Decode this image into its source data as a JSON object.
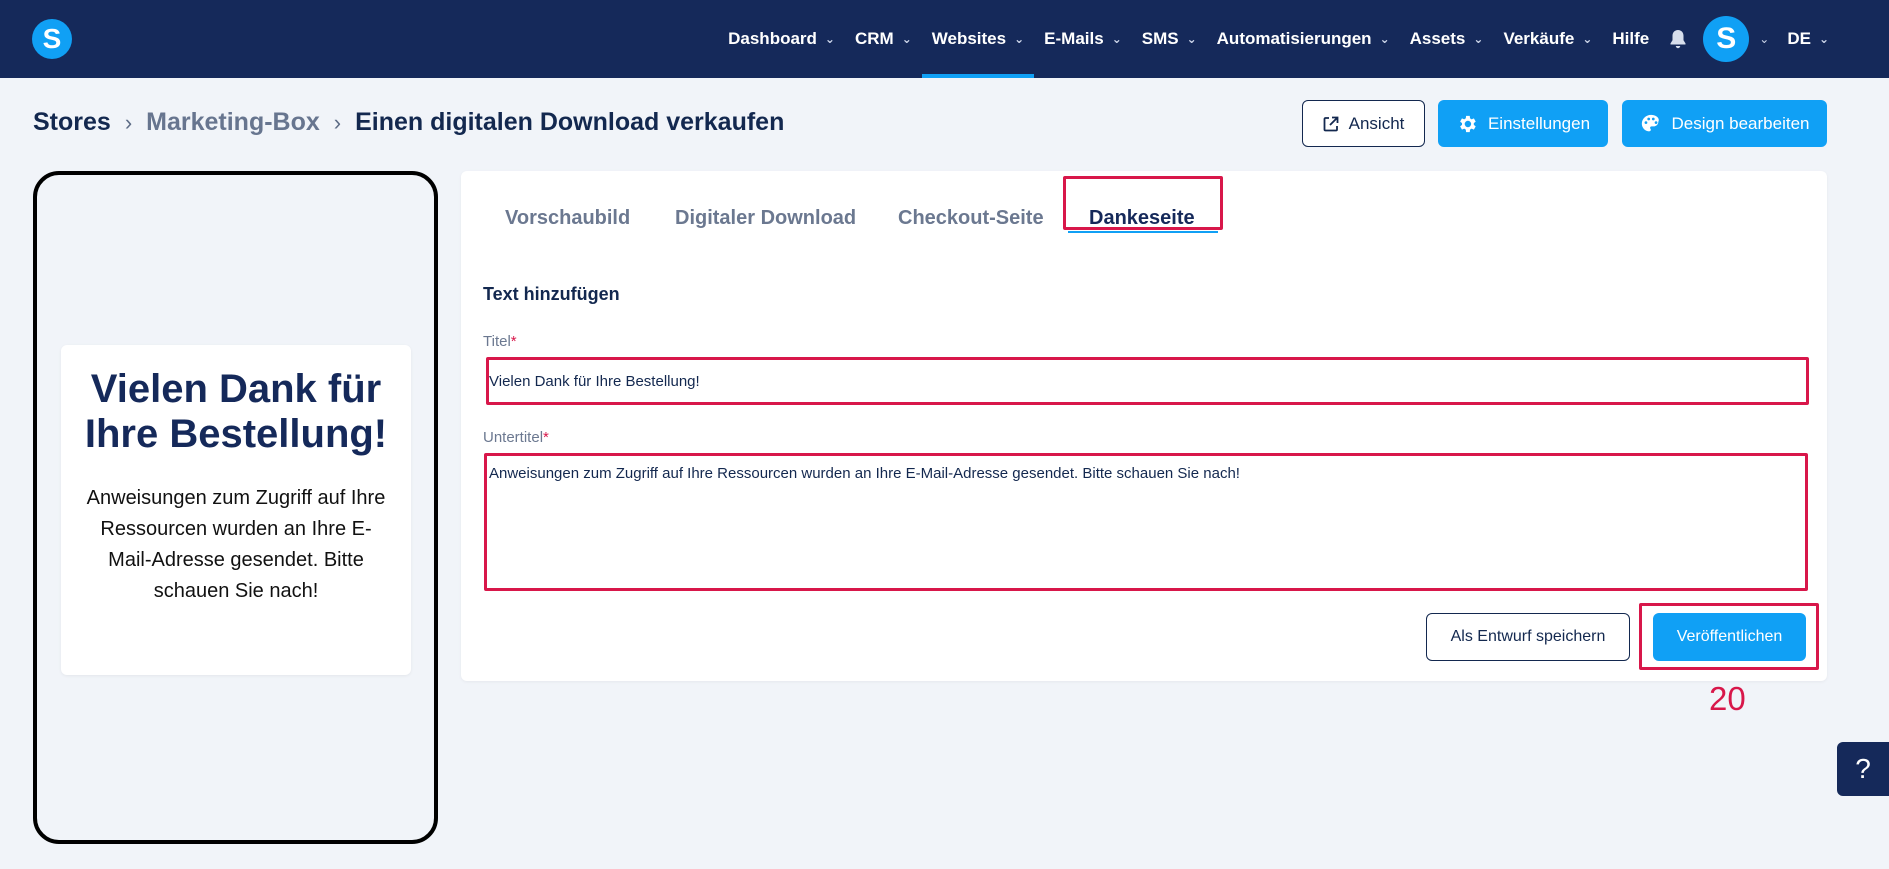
{
  "nav": {
    "logo_letter": "S",
    "items": [
      {
        "label": "Dashboard",
        "dropdown": true
      },
      {
        "label": "CRM",
        "dropdown": true
      },
      {
        "label": "Websites",
        "dropdown": true,
        "active": true
      },
      {
        "label": "E-Mails",
        "dropdown": true
      },
      {
        "label": "SMS",
        "dropdown": true
      },
      {
        "label": "Automatisierungen",
        "dropdown": true
      },
      {
        "label": "Assets",
        "dropdown": true
      },
      {
        "label": "Verkäufe",
        "dropdown": true
      },
      {
        "label": "Hilfe",
        "dropdown": false
      }
    ],
    "bell_icon": "bell-icon",
    "avatar_letter": "S",
    "language": "DE"
  },
  "breadcrumb": {
    "root": "Stores",
    "middle": "Marketing-Box",
    "current": "Einen digitalen Download verkaufen"
  },
  "header_buttons": {
    "view": "Ansicht",
    "settings": "Einstellungen",
    "design": "Design bearbeiten"
  },
  "preview": {
    "title": "Vielen Dank für Ihre Bestellung!",
    "subtitle": "Anweisungen zum Zugriff auf Ihre Ressourcen wurden an Ihre E-Mail-Adresse gesendet. Bitte schauen Sie nach!"
  },
  "tabs": [
    "Vorschaubild",
    "Digitaler Download",
    "Checkout-Seite",
    "Dankeseite"
  ],
  "active_tab": "Dankeseite",
  "form": {
    "section_title": "Text hinzufügen",
    "title_label": "Titel",
    "title_value": "Vielen Dank für Ihre Bestellung!",
    "subtitle_label": "Untertitel",
    "subtitle_value": "Anweisungen zum Zugriff auf Ihre Ressourcen wurden an Ihre E-Mail-Adresse gesendet. Bitte schauen Sie nach!",
    "required_marker": "*"
  },
  "actions": {
    "draft": "Als Entwurf speichern",
    "publish": "Veröffentlichen"
  },
  "step_number": "20",
  "help_label": "?",
  "colors": {
    "navbar": "#15295a",
    "accent": "#10a0f5",
    "highlight": "#d8174a",
    "background": "#f1f4f9"
  }
}
